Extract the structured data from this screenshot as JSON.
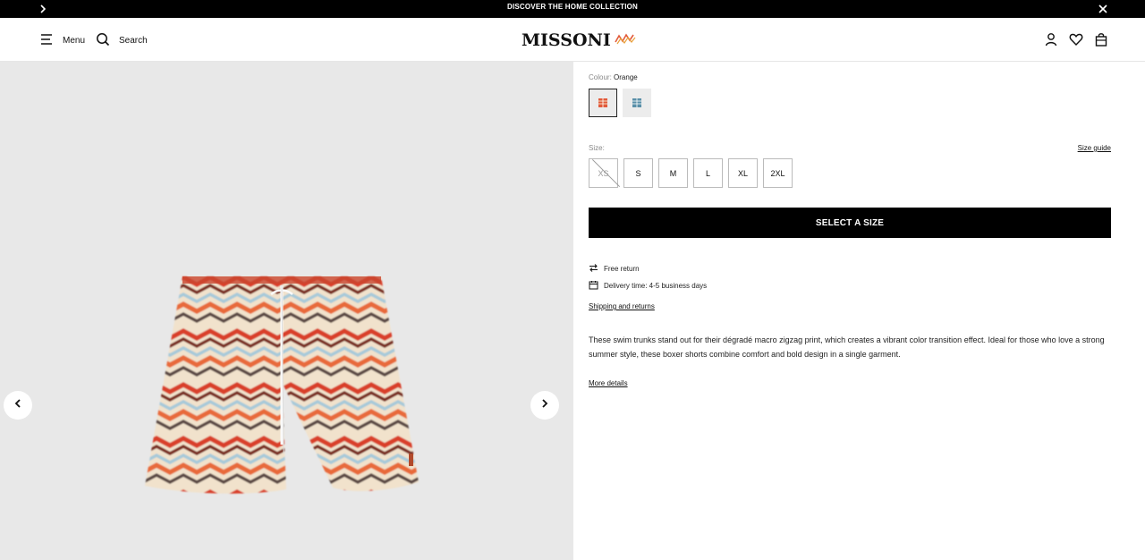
{
  "promo": {
    "text": "DISCOVER THE HOME COLLECTION",
    "arrow_icon": "chevron-right-icon",
    "close_icon": "close-icon"
  },
  "header": {
    "menu_label": "Menu",
    "search_label": "Search",
    "logo_text": "MISSONI",
    "icons": [
      "account-icon",
      "wishlist-heart-icon",
      "shopping-bag-icon"
    ]
  },
  "gallery": {
    "prev_icon": "chevron-left-icon",
    "next_icon": "chevron-right-icon"
  },
  "product": {
    "colour_label": "Colour:",
    "colour_value": "Orange",
    "swatches": [
      {
        "name": "Orange",
        "selected": true,
        "color": "#e25a3a"
      },
      {
        "name": "Blue",
        "selected": false,
        "color": "#5a8fa8"
      }
    ],
    "size_label": "Size:",
    "size_guide": "Size guide",
    "sizes": [
      {
        "label": "XS",
        "available": false
      },
      {
        "label": "S",
        "available": true
      },
      {
        "label": "M",
        "available": true
      },
      {
        "label": "L",
        "available": true
      },
      {
        "label": "XL",
        "available": true
      },
      {
        "label": "2XL",
        "available": true
      }
    ],
    "cta_label": "SELECT A SIZE",
    "free_return": "Free return",
    "delivery": "Delivery time: 4-5 business days",
    "shipping_link": "Shipping and returns",
    "description": "These swim trunks stand out for their dégradé macro zigzag print, which creates a vibrant color transition effect. Ideal for those who love a strong summer style, these boxer shorts combine comfort and bold design in a single garment.",
    "more_details": "More details"
  },
  "colors": {
    "black": "#000000",
    "gallery_bg": "#e8e8e8",
    "accent_orange": "#e25a3a"
  }
}
